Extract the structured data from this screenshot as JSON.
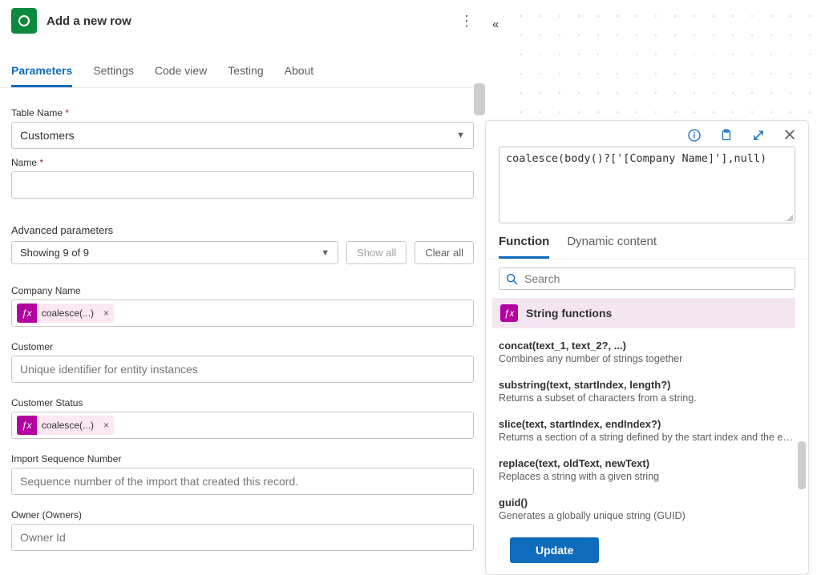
{
  "header": {
    "title": "Add a new row"
  },
  "tabs": [
    "Parameters",
    "Settings",
    "Code view",
    "Testing",
    "About"
  ],
  "form": {
    "tableName": {
      "label": "Table Name",
      "required": true,
      "value": "Customers"
    },
    "name": {
      "label": "Name",
      "required": true,
      "value": ""
    },
    "advanced": {
      "label": "Advanced parameters",
      "summary": "Showing 9 of 9",
      "showAll": "Show all",
      "clearAll": "Clear all"
    },
    "companyName": {
      "label": "Company Name",
      "token": "coalesce(...)"
    },
    "customer": {
      "label": "Customer",
      "placeholder": "Unique identifier for entity instances"
    },
    "customerStatus": {
      "label": "Customer Status",
      "token": "coalesce(...)"
    },
    "importSeq": {
      "label": "Import Sequence Number",
      "placeholder": "Sequence number of the import that created this record."
    },
    "owner": {
      "label": "Owner (Owners)",
      "placeholder": "Owner Id"
    }
  },
  "expression": {
    "text": "coalesce(body()?['[Company Name]'],null)",
    "tabs": {
      "function": "Function",
      "dynamic": "Dynamic content"
    },
    "searchPlaceholder": "Search",
    "category": "String functions",
    "functions": [
      {
        "sig": "concat(text_1, text_2?, ...)",
        "desc": "Combines any number of strings together"
      },
      {
        "sig": "substring(text, startIndex, length?)",
        "desc": "Returns a subset of characters from a string."
      },
      {
        "sig": "slice(text, startIndex, endIndex?)",
        "desc": "Returns a section of a string defined by the start index and the end..."
      },
      {
        "sig": "replace(text, oldText, newText)",
        "desc": "Replaces a string with a given string"
      },
      {
        "sig": "guid()",
        "desc": "Generates a globally unique string (GUID)"
      }
    ],
    "updateLabel": "Update"
  }
}
